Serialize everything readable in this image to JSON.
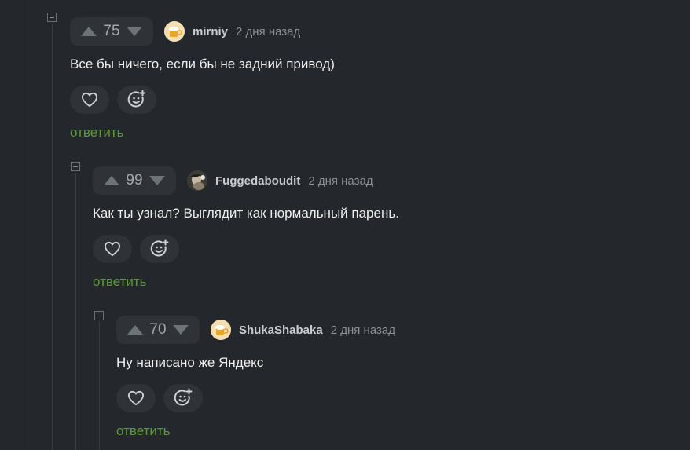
{
  "comments": [
    {
      "score": "75",
      "author": "mirniy",
      "time": "2 дня назад",
      "text": "Все бы ничего, если бы не задний привод)",
      "reply_label": "ответить",
      "avatar": "beer-mug-avatar"
    },
    {
      "score": "99",
      "author": "Fuggedaboudit",
      "time": "2 дня назад",
      "text": "Как ты узнал? Выглядит как нормальный парень.",
      "reply_label": "ответить",
      "avatar": "user-photo-avatar"
    },
    {
      "score": "70",
      "author": "ShukaShabaka",
      "time": "2 дня назад",
      "text": "Ну написано же Яндекс",
      "reply_label": "ответить",
      "avatar": "beer-mug-avatar"
    }
  ],
  "icons": {
    "upvote": "upvote-arrow-icon",
    "downvote": "downvote-arrow-icon",
    "like": "heart-icon",
    "react": "smiley-plus-icon",
    "collapse": "collapse-minus-icon"
  },
  "colors": {
    "background": "#24272b",
    "reply_link": "#5e9a35",
    "pill": "#2f3338"
  }
}
